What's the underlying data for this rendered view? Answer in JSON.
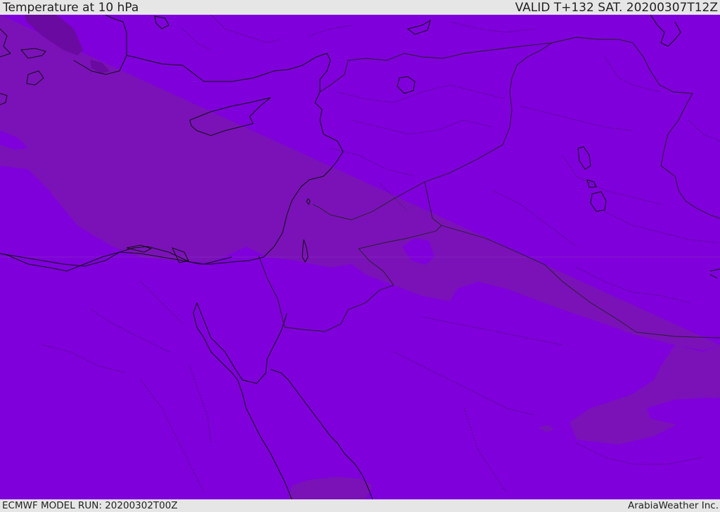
{
  "header": {
    "title": "Temperature at 10 hPa",
    "valid": "VALID T+132 SAT. 20200307T12Z"
  },
  "footer": {
    "model_run": "ECMWF MODEL RUN: 20200302T00Z",
    "credit": "ArabiaWeather Inc."
  },
  "map": {
    "region": "Eastern Mediterranean / Middle East",
    "colors": {
      "warm_band": "#7a12b8",
      "cool_band": "#7f00db",
      "coldest_patch": "#6a0aa0",
      "coastline": "#111111",
      "borders": "#222222"
    }
  }
}
